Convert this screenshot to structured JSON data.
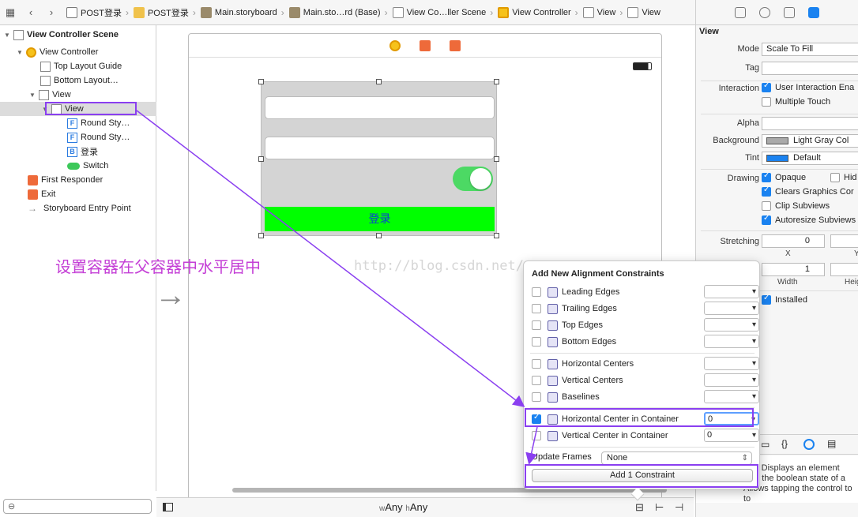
{
  "jumpbar": {
    "crumbs": [
      {
        "label": "POST登录",
        "icon": "project-icon"
      },
      {
        "label": "POST登录",
        "icon": "folder-icon"
      },
      {
        "label": "Main.storyboard",
        "icon": "storyboard-icon"
      },
      {
        "label": "Main.sto…rd (Base)",
        "icon": "storyboard-icon"
      },
      {
        "label": "View Co…ller Scene",
        "icon": "scene-icon"
      },
      {
        "label": "View Controller",
        "icon": "view-controller-icon"
      },
      {
        "label": "View",
        "icon": "view-icon"
      },
      {
        "label": "View",
        "icon": "view-icon"
      }
    ]
  },
  "outline": {
    "scene_title": "View Controller Scene",
    "view_controller": "View Controller",
    "top_guide": "Top Layout Guide",
    "bottom_guide": "Bottom Layout…",
    "root_view": "View",
    "child_view": "View",
    "field1": "Round Sty…",
    "field2": "Round Sty…",
    "button": "登录",
    "switch": "Switch",
    "first_responder": "First Responder",
    "exit": "Exit",
    "entry_point": "Storyboard Entry Point",
    "tf_glyph": "F",
    "btn_glyph": "B"
  },
  "canvas": {
    "login_button": "登录",
    "annotation": "设置容器在父容器中水平居中",
    "watermark": "http://blog.csdn.net/",
    "switch_on": true
  },
  "bottombar": {
    "w_prefix": "w",
    "w_value": "Any",
    "h_prefix": "h",
    "h_value": "Any"
  },
  "inspector": {
    "section": "View",
    "mode_label": "Mode",
    "mode_value": "Scale To Fill",
    "tag_label": "Tag",
    "tag_value": "",
    "interaction_label": "Interaction",
    "user_interaction": "User Interaction Ena",
    "multiple_touch": "Multiple Touch",
    "alpha_label": "Alpha",
    "alpha_value": "",
    "background_label": "Background",
    "background_value": "Light Gray Col",
    "tint_label": "Tint",
    "tint_value": "Default",
    "drawing_label": "Drawing",
    "opaque": "Opaque",
    "hidden": "Hid",
    "clears": "Clears Graphics Cor",
    "clip": "Clip Subviews",
    "autoresize": "Autoresize Subviews",
    "stretching_label": "Stretching",
    "stretch_x_value": "0",
    "stretch_x_label": "X",
    "stretch_y_label": "Y",
    "stretch_w_value": "1",
    "stretch_w_label": "Width",
    "stretch_h_label": "Heig",
    "installed": "Installed",
    "colors": {
      "background": "#aaaaaa",
      "tint": "#1a82f0"
    },
    "lib_desc_bold": "ch",
    "lib_desc_1": " - Displays an element",
    "lib_desc_2": "ving the boolean state of a",
    "lib_desc_3": "Allows tapping the control to to"
  },
  "popover": {
    "title": "Add New Alignment Constraints",
    "rows": [
      {
        "label": "Leading Edges",
        "checked": false,
        "value": ""
      },
      {
        "label": "Trailing Edges",
        "checked": false,
        "value": ""
      },
      {
        "label": "Top Edges",
        "checked": false,
        "value": ""
      },
      {
        "label": "Bottom Edges",
        "checked": false,
        "value": ""
      },
      {
        "label": "Horizontal Centers",
        "checked": false,
        "value": ""
      },
      {
        "label": "Vertical Centers",
        "checked": false,
        "value": ""
      },
      {
        "label": "Baselines",
        "checked": false,
        "value": ""
      },
      {
        "label": "Horizontal Center in Container",
        "checked": true,
        "value": "0"
      },
      {
        "label": "Vertical Center in Container",
        "checked": false,
        "value": "0"
      }
    ],
    "update_frames_label": "Update Frames",
    "update_frames_value": "None",
    "add_button": "Add 1 Constraint"
  },
  "colors": {
    "accent": "#8a3ff0",
    "annotation": "#c43fd6",
    "login_bg": "#00ff00",
    "switch_on": "#4cd964"
  }
}
